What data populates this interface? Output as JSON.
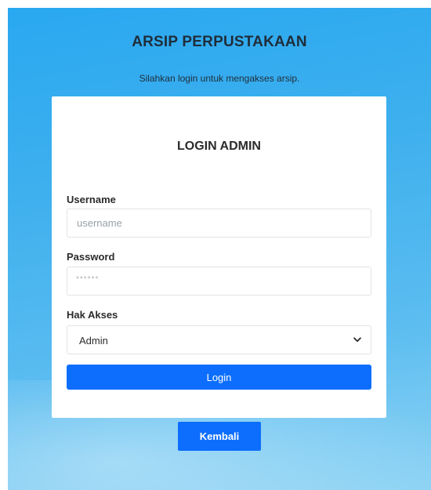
{
  "header": {
    "title": "ARSIP PERPUSTAKAAN",
    "subtitle": "Silahkan login untuk mengakses arsip."
  },
  "login_card": {
    "title": "LOGIN ADMIN",
    "username": {
      "label": "Username",
      "placeholder": "username",
      "value": ""
    },
    "password": {
      "label": "Password",
      "placeholder": "******",
      "value": ""
    },
    "access": {
      "label": "Hak Akses",
      "selected": "Admin"
    },
    "submit_label": "Login"
  },
  "back_button_label": "Kembali",
  "colors": {
    "primary": "#0d6efd",
    "background_top": "#29a8f0",
    "background_bottom": "#8ed3f4"
  },
  "icons": {
    "select_chevron": "chevron-down-icon"
  }
}
